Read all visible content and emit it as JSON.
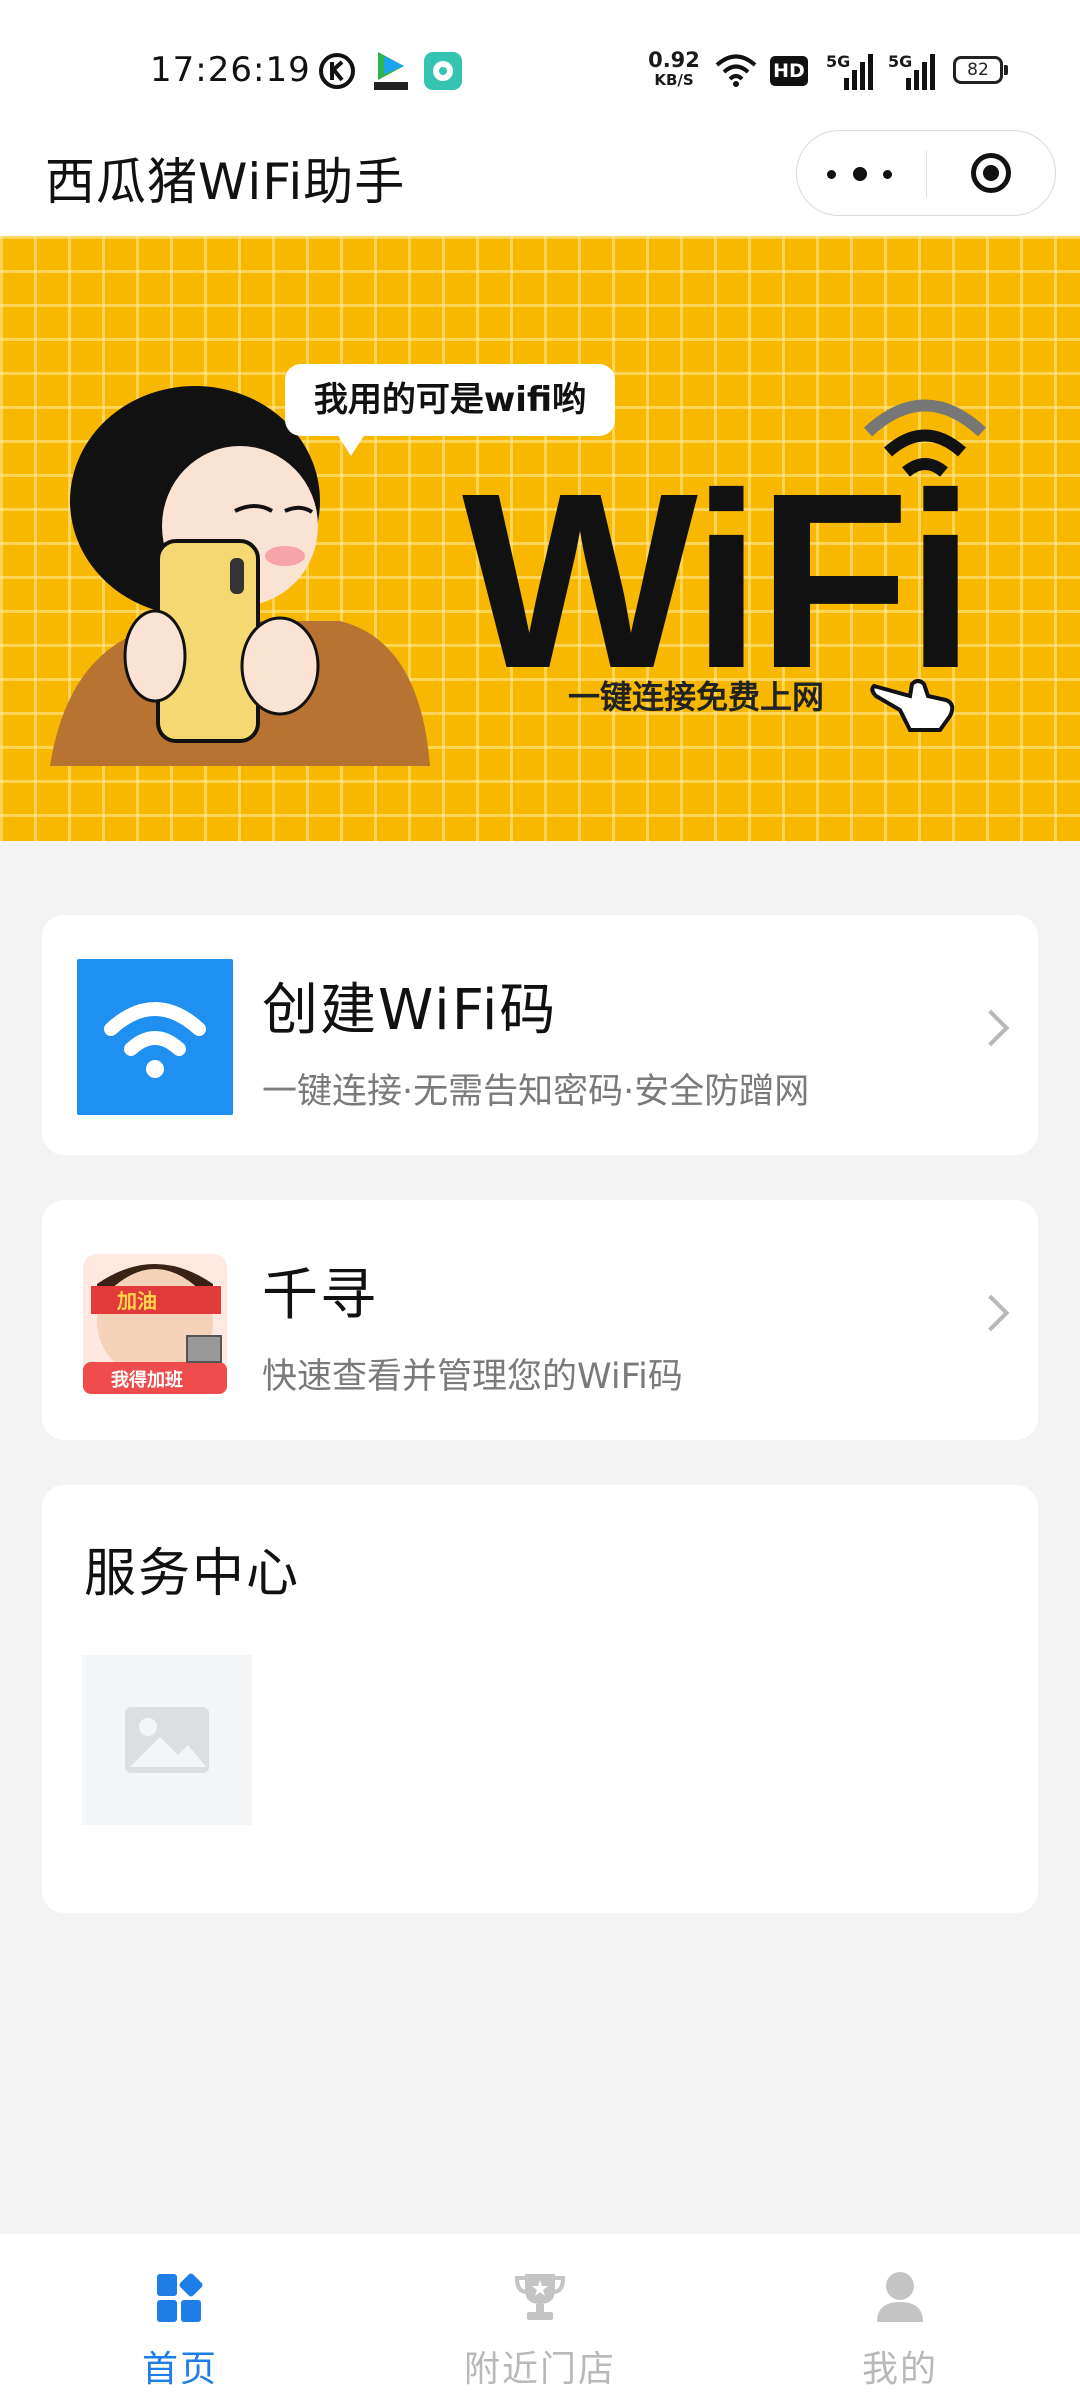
{
  "status_bar": {
    "time": "17:26:19",
    "net_speed_value": "0.92",
    "net_speed_unit": "KB/S",
    "hd_label": "HD",
    "signal1_label": "5G",
    "signal2_label": "5G",
    "battery": "82"
  },
  "header": {
    "title": "西瓜猪WiFi助手"
  },
  "banner": {
    "bubble_text": "我用的可是wifi哟",
    "big_text": "WiFi",
    "slogan": "一键连接免费上网"
  },
  "cards": [
    {
      "title": "创建WiFi码",
      "subtitle": "一键连接·无需告知密码·安全防蹭网"
    },
    {
      "title": "千寻",
      "subtitle": "快速查看并管理您的WiFi码"
    }
  ],
  "service_center": {
    "title": "服务中心"
  },
  "avatar_art_text": [
    "加油",
    "我得加班"
  ],
  "tabs": [
    {
      "label": "首页",
      "icon": "home-grid-icon",
      "active": true
    },
    {
      "label": "附近门店",
      "icon": "trophy-icon",
      "active": false
    },
    {
      "label": "我的",
      "icon": "person-icon",
      "active": false
    }
  ],
  "colors": {
    "accent": "#1f7de8",
    "banner_yellow": "#f8b800",
    "wifi_tile": "#1f8ff2",
    "page_bg": "#f3f3f4"
  }
}
